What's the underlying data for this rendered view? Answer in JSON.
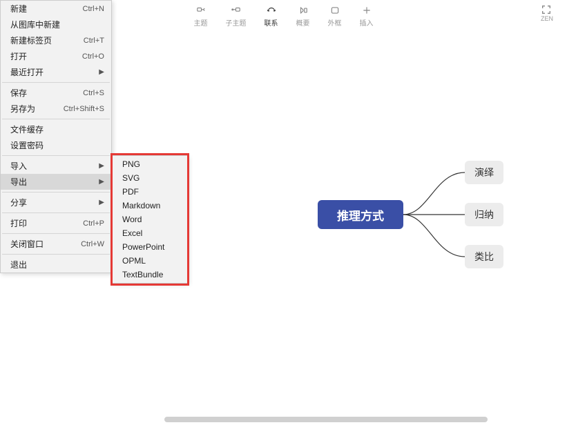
{
  "toolbar": {
    "items": [
      {
        "id": "topic",
        "label": "主题"
      },
      {
        "id": "subtopic",
        "label": "子主题"
      },
      {
        "id": "relation",
        "label": "联系"
      },
      {
        "id": "summary",
        "label": "概要"
      },
      {
        "id": "boundary",
        "label": "外框"
      },
      {
        "id": "insert",
        "label": "插入"
      }
    ],
    "active_index": 2,
    "zen_label": "ZEN"
  },
  "menu": [
    {
      "type": "item",
      "name": "新建",
      "shortcut": "Ctrl+N"
    },
    {
      "type": "item",
      "name": "从图库中新建"
    },
    {
      "type": "item",
      "name": "新建标签页",
      "shortcut": "Ctrl+T"
    },
    {
      "type": "item",
      "name": "打开",
      "shortcut": "Ctrl+O"
    },
    {
      "type": "item",
      "name": "最近打开",
      "submenu": true
    },
    {
      "type": "sep"
    },
    {
      "type": "item",
      "name": "保存",
      "shortcut": "Ctrl+S"
    },
    {
      "type": "item",
      "name": "另存为",
      "shortcut": "Ctrl+Shift+S"
    },
    {
      "type": "sep"
    },
    {
      "type": "item",
      "name": "文件缓存"
    },
    {
      "type": "item",
      "name": "设置密码"
    },
    {
      "type": "sep"
    },
    {
      "type": "item",
      "name": "导入",
      "submenu": true
    },
    {
      "type": "item",
      "name": "导出",
      "submenu": true,
      "highlight": true
    },
    {
      "type": "sep"
    },
    {
      "type": "item",
      "name": "分享",
      "submenu": true
    },
    {
      "type": "sep"
    },
    {
      "type": "item",
      "name": "打印",
      "shortcut": "Ctrl+P"
    },
    {
      "type": "sep"
    },
    {
      "type": "item",
      "name": "关闭窗口",
      "shortcut": "Ctrl+W"
    },
    {
      "type": "sep"
    },
    {
      "type": "item",
      "name": "退出"
    }
  ],
  "export_submenu": [
    "PNG",
    "SVG",
    "PDF",
    "Markdown",
    "Word",
    "Excel",
    "PowerPoint",
    "OPML",
    "TextBundle"
  ],
  "mindmap": {
    "central": "推理方式",
    "children": [
      "演绎",
      "归纳",
      "类比"
    ]
  },
  "scrollbar": {
    "thumb_left_pct": 29,
    "thumb_width_pct": 57
  }
}
